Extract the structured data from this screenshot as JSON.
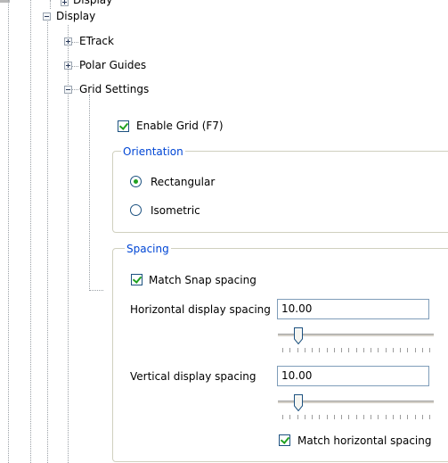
{
  "tree": {
    "top_item_label": "Display",
    "display_label": "Display",
    "items": [
      {
        "label": "ETrack",
        "expanded": false
      },
      {
        "label": "Polar Guides",
        "expanded": false
      },
      {
        "label": "Grid Settings",
        "expanded": true
      }
    ]
  },
  "grid_settings": {
    "enable_grid": {
      "label": "Enable Grid (F7)",
      "checked": true
    },
    "orientation": {
      "title": "Orientation",
      "options": [
        {
          "label": "Rectangular",
          "selected": true
        },
        {
          "label": "Isometric",
          "selected": false
        }
      ]
    },
    "spacing": {
      "title": "Spacing",
      "match_snap": {
        "label": "Match Snap spacing",
        "checked": true
      },
      "horizontal": {
        "label": "Horizontal display spacing",
        "value": "10.00",
        "slider_fraction": 0.11
      },
      "vertical": {
        "label": "Vertical display spacing",
        "value": "10.00",
        "slider_fraction": 0.11
      },
      "match_horizontal": {
        "label": "Match horizontal spacing",
        "checked": true
      }
    }
  },
  "colors": {
    "group_title": "#0046d5",
    "check_mark": "#21a121",
    "control_border": "#1c5180",
    "group_border": "#d0d0bf"
  }
}
